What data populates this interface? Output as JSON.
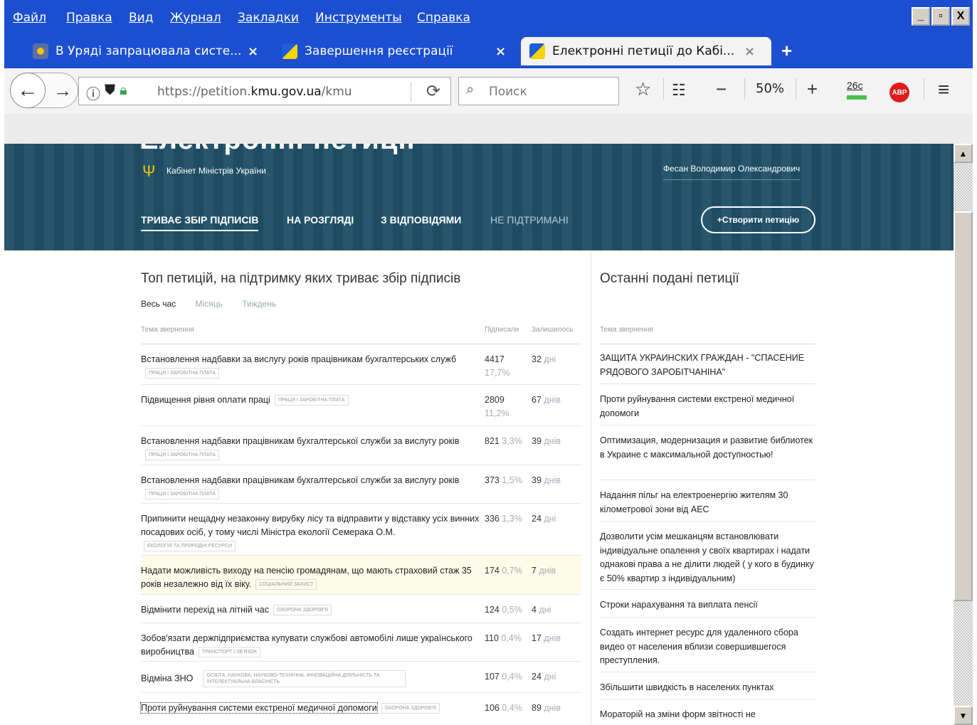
{
  "window": {
    "menu": [
      "Файл",
      "Правка",
      "Вид",
      "Журнал",
      "Закладки",
      "Инструменты",
      "Справка"
    ],
    "controls": [
      "_",
      "▫",
      "X"
    ]
  },
  "tabs": [
    {
      "title": "В Уряді запрацювала систе...",
      "close": "×"
    },
    {
      "title": "Завершення реєстрації",
      "close": "×"
    },
    {
      "title": "Електронні петиції до Кабі...",
      "close": "×"
    }
  ],
  "newtab": "+",
  "toolbar": {
    "url_prefix": "https://petition.",
    "url_domain": "kmu.gov.ua",
    "url_suffix": "/kmu",
    "search_placeholder": "Поиск",
    "zoom": "50%",
    "zoom_minus": "−",
    "zoom_plus": "+",
    "weather": "26c",
    "abp": "ABP"
  },
  "site": {
    "hero_title": "Електронні петиції",
    "gov_name": "Кабінет Міністрів України",
    "user_name": "Фесан Володимир Олександрович",
    "tabs": [
      "ТРИВАЄ ЗБІР ПІДПИСІВ",
      "НА РОЗГЛЯДІ",
      "З ВІДПОВІДЯМИ",
      "НЕ ПІДТРИМАНІ"
    ],
    "create_button": "+Створити петицію"
  },
  "top": {
    "title": "Топ петицій, на підтримку яких триває збір підписів",
    "filters": [
      "Весь час",
      "Місяць",
      "Тиждень"
    ],
    "col_topic": "Тема звернення",
    "col_signed": "Підписали",
    "col_left": "Залишилось",
    "rows": [
      {
        "title": "Встановлення надбавки за вислугу років працівникам бухгалтерських служб",
        "tag": "праця і заробітна плата",
        "signed": "4417",
        "pct": "17,7%",
        "left": "32",
        "unit": "дні"
      },
      {
        "title": "Підвищення рівня оплати праці",
        "tag": "праця і заробітна плата",
        "signed": "2809",
        "pct": "11,2%",
        "left": "67",
        "unit": "днів"
      },
      {
        "title": "Встановлення надбавки працівникам бухгалтерської служби за вислугу років",
        "tag": "праця і заробітна плата",
        "signed": "821",
        "pct": "3,3%",
        "left": "39",
        "unit": "днів"
      },
      {
        "title": "Встановлення надбавки працівникам бухгалтерської служби за вислугу років",
        "tag": "праця і заробітна плата",
        "signed": "373",
        "pct": "1,5%",
        "left": "39",
        "unit": "днів"
      },
      {
        "title": "Припинити нещадну незаконну вирубку лісу та відправити у відставку усіх винних посадових осіб, у тому числі Міністра екології Семерака О.М.",
        "tag": "екологія та природні ресурси",
        "signed": "336",
        "pct": "1,3%",
        "left": "24",
        "unit": "дні"
      },
      {
        "title": "Надати можливість виходу на пенсію громадянам, що мають страховий стаж 35 років незалежно від їх віку.",
        "tag": "соціальний захист",
        "signed": "174",
        "pct": "0,7%",
        "left": "7",
        "unit": "днів"
      },
      {
        "title": "Відмінити перехід на літній час",
        "tag": "охорона здоров'я",
        "signed": "124",
        "pct": "0,5%",
        "left": "4",
        "unit": "дні"
      },
      {
        "title": "Зобов'язати держпідприємства купувати службові автомобілі лише українського виробництва",
        "tag": "транспорт і зв'язок",
        "signed": "110",
        "pct": "0,4%",
        "left": "17",
        "unit": "днів"
      },
      {
        "title": "Відміна ЗНО",
        "tag": "освіта, наукова, науково-технічна, інноваційна діяльність та інтелектуальна власність",
        "signed": "107",
        "pct": "0,4%",
        "left": "24",
        "unit": "дні"
      },
      {
        "title": "Проти руйнування системи екстреної медичної допомоги",
        "tag": "охорона здоров'я",
        "signed": "106",
        "pct": "0,4%",
        "left": "89",
        "unit": "днів"
      }
    ]
  },
  "recent": {
    "title": "Останні подані петиції",
    "col_topic": "Тема звернення",
    "items": [
      "ЗАЩИТА УКРАИНСКИХ ГРАЖДАН - \"СПАСЕНИЕ РЯДОВОГО ЗАРОБІТЧАНІНА\"",
      "Проти руйнування системи екстреної медичної допомоги",
      "Оптимизация, модернизация и развитие библиотек в Украине с максимальной доступностью!",
      "Надання пільг на електроенергію жителям 30 кілометрової зони від АЕС",
      "Дозволити усім мешканцям встановлювати індивідуальне опалення у своїх квартирах і надати однакові права а не ділити людей ( у кого в будинку є 50% квартир з індивідуальним)",
      "Строки нарахування та виплата пенсії",
      "Создать интернет ресурс для удаленного сбора видео от населения вблизи совершившегося преступления.",
      "Збільшити швидкість в населених пунктах",
      "Мораторій на зміни форм звітності не"
    ]
  }
}
